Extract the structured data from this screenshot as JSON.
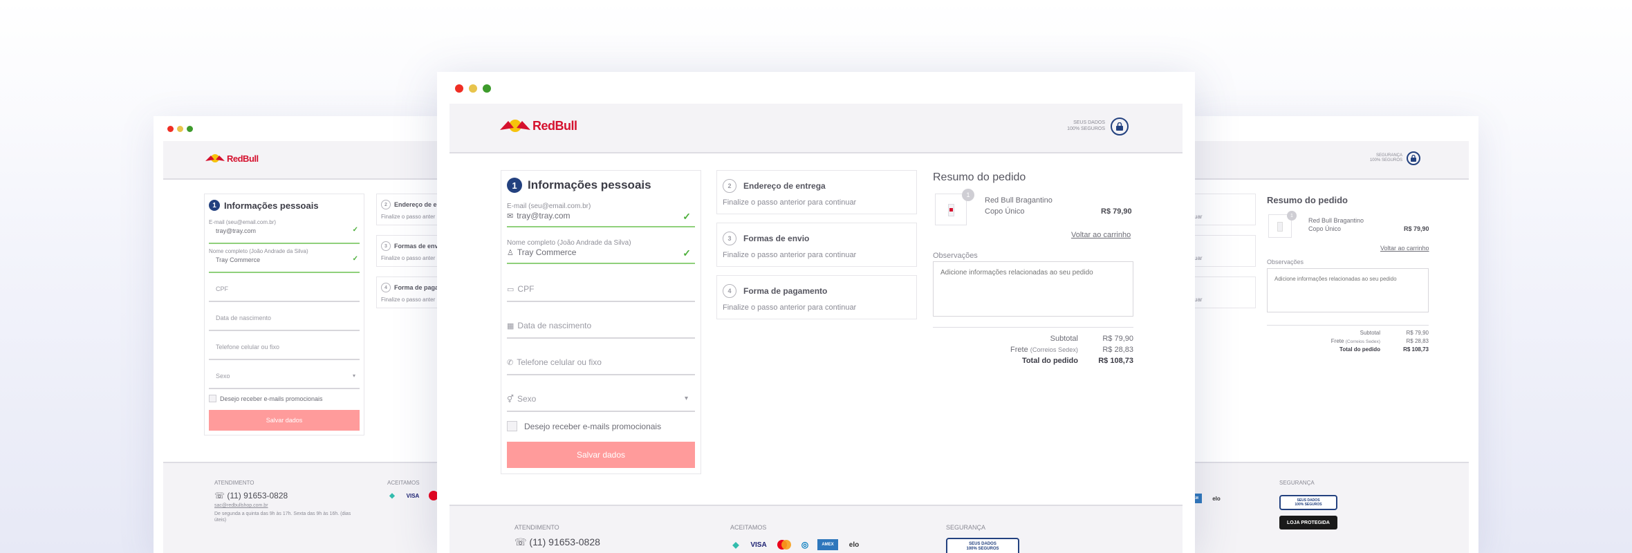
{
  "brand": {
    "name": "RedBull",
    "accent": "#d5112e",
    "primary": "#23417f",
    "save_button_color": "#ff9b9b"
  },
  "header": {
    "security_line1": "SEUS DADOS",
    "security_line2": "100% SEGUROS",
    "security_icon": "lock-icon"
  },
  "left_header": {
    "security_line1": "SEUS DADOS",
    "security_line2": "100% SEGUROS"
  },
  "right_header": {
    "security_line1": "SEGURANÇA",
    "security_line2": "100% SEGUROS"
  },
  "personal": {
    "step": "1",
    "title": "Informações pessoais",
    "email_label": "E-mail (seu@email.com.br)",
    "email_value": "tray@tray.com",
    "name_label": "Nome completo (João Andrade da Silva)",
    "name_value": "Tray Commerce",
    "cpf_placeholder": "CPF",
    "birth_placeholder": "Data de nascimento",
    "phone_placeholder": "Telefone celular ou fixo",
    "gender_placeholder": "Sexo",
    "newsletter_label": "Desejo receber e-mails promocionais",
    "save_label": "Salvar dados"
  },
  "steps": [
    {
      "number": "2",
      "title": "Endereço de entrega",
      "subtitle": "Finalize o passo anterior para continuar"
    },
    {
      "number": "3",
      "title": "Formas de envio",
      "subtitle": "Finalize o passo anterior para continuar"
    },
    {
      "number": "4",
      "title": "Forma de pagamento",
      "subtitle": "Finalize o passo anterior para continuar"
    }
  ],
  "left_steps": [
    {
      "number": "2",
      "title": "Endereço de en",
      "subtitle": "Finalize o passo anter"
    },
    {
      "number": "3",
      "title": "Formas de envi",
      "subtitle": "Finalize o passo anter"
    },
    {
      "number": "4",
      "title": "Forma de paga",
      "subtitle": "Finalize o passo anter"
    }
  ],
  "right_steps": [
    {
      "subtitle": "uar"
    },
    {
      "subtitle": "uar"
    },
    {
      "subtitle": "uar"
    }
  ],
  "summary": {
    "title": "Resumo do pedido",
    "qty": "1",
    "product_name": "Red Bull Bragantino",
    "product_variant": "Copo Único",
    "product_price": "R$ 79,90",
    "back_link": "Voltar ao carrinho",
    "obs_label": "Observações",
    "obs_placeholder": "Adicione informações relacionadas ao seu pedido",
    "subtotal_label": "Subtotal",
    "subtotal_value": "R$ 79,90",
    "shipping_label": "Frete",
    "shipping_detail": "(Correios Sedex)",
    "shipping_value": "R$ 28,83",
    "total_label": "Total do pedido",
    "total_value": "R$ 108,73"
  },
  "footer": {
    "service_title": "ATENDIMENTO",
    "phone": "(11) 91653-0828",
    "email": "sac@redbullshop.com.br",
    "hours": "De segunda a quinta das 9h às 17h. Sexta das 9h às 16h. (dias úteis)",
    "payments_title": "ACEITAMOS",
    "security_title": "SEGURANÇA",
    "seal_secure_line1": "SEUS DADOS",
    "seal_secure_line2": "100% SEGUROS",
    "seal_store": "LOJA PROTEGIDA",
    "payment_methods": [
      "Pix",
      "VISA",
      "Mastercard",
      "Diners",
      "American Express",
      "Elo"
    ]
  }
}
